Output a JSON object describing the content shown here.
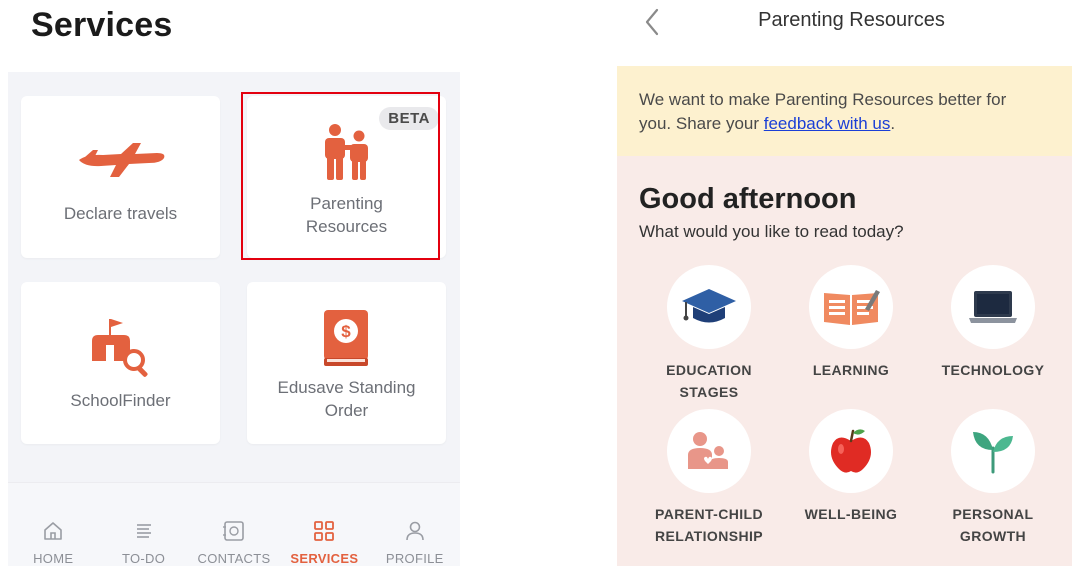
{
  "left_screen": {
    "title": "Services",
    "cards": {
      "declare_travels": "Declare travels",
      "parenting_line1": "Parenting",
      "parenting_line2": "Resources",
      "beta": "BETA",
      "schoolfinder": "SchoolFinder",
      "edusave_line1": "Edusave Standing",
      "edusave_line2": "Order"
    },
    "nav": {
      "home": "HOME",
      "todo": "TO-DO",
      "contacts": "CONTACTS",
      "services": "SERVICES",
      "profile": "PROFILE",
      "active": "SERVICES"
    }
  },
  "right_screen": {
    "header_title": "Parenting Resources",
    "banner": {
      "text_line1": "We want to make Parenting Resources better for",
      "text_line2_prefix": "you. Share your ",
      "link": "feedback with us",
      "text_line2_suffix": "."
    },
    "greeting": "Good afternoon",
    "subgreeting": "What would you like to read today?",
    "topics": {
      "education_line1": "EDUCATION",
      "education_line2": "STAGES",
      "learning": "LEARNING",
      "technology": "TECHNOLOGY",
      "parent_child_line1": "PARENT-CHILD",
      "parent_child_line2": "RELATIONSHIP",
      "wellbeing": "WELL-BEING",
      "growth_line1": "PERSONAL",
      "growth_line2": "GROWTH"
    }
  },
  "colors": {
    "accent": "#e3613f",
    "highlight_border": "#e3000f",
    "banner_bg": "#fdf1cf",
    "content_bg": "#f9ebe8",
    "link": "#1b3fd6"
  },
  "icons": {
    "declare_travels": "airplane-icon",
    "parenting": "parent-child-icon",
    "schoolfinder": "school-search-icon",
    "edusave": "dollar-book-icon",
    "home": "home-icon",
    "todo": "list-icon",
    "contacts": "contacts-icon",
    "services": "grid-icon",
    "profile": "person-icon",
    "back": "chevron-left-icon"
  }
}
